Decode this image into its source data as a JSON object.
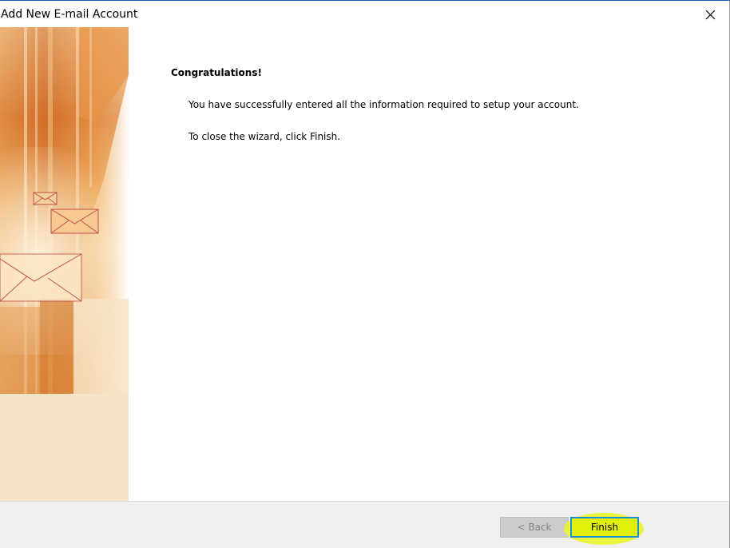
{
  "window": {
    "title": "Add New E-mail Account"
  },
  "content": {
    "heading": "Congratulations!",
    "paragraphs": [
      "You have successfully entered all the information required to setup your account.",
      "To close the wizard, click Finish."
    ]
  },
  "footer": {
    "back_label": "< Back",
    "finish_label": "Finish"
  },
  "icons": {
    "close": "close-icon",
    "envelopes": [
      "envelope-icon",
      "envelope-icon",
      "envelope-icon"
    ]
  },
  "colors": {
    "finish_highlight": "#e1f00a",
    "finish_border": "#1c8fd6",
    "art_orange": "#d0702a",
    "art_cream": "#f5e4c6"
  }
}
